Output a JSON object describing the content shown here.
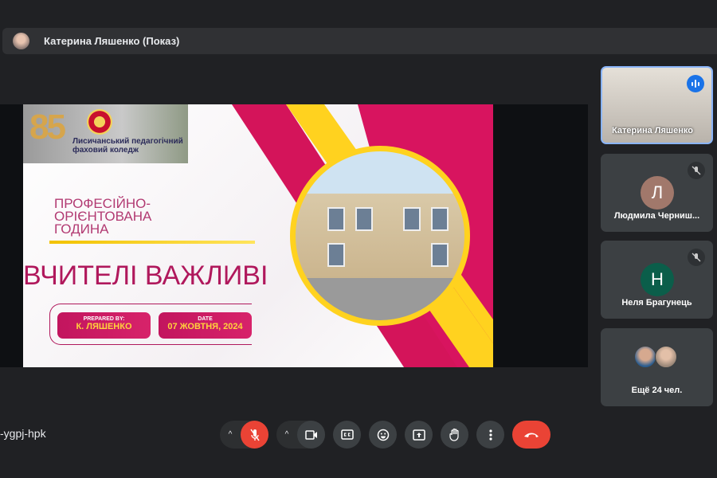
{
  "presenter_bar": {
    "title": "Катерина Ляшенко (Показ)"
  },
  "slide": {
    "logo_number": "85",
    "logo_line1": "Лисичанський педагогічний",
    "logo_line2": "фаховий коледж",
    "subtitle_line1": "ПРОФЕСІЙНО-",
    "subtitle_line2": "ОРІЄНТОВАНА",
    "subtitle_line3": "ГОДИНА",
    "headline": "ВЧИТЕЛІ ВАЖЛИВІ",
    "prepared_label": "PREPARED BY:",
    "prepared_value": "К. ЛЯШЕНКО",
    "date_label": "DATE",
    "date_value": "07 ЖОВТНЯ, 2024"
  },
  "participants": [
    {
      "name": "Катерина Ляшенко",
      "speaking": true
    },
    {
      "name": "Людмила Черниш...",
      "initial": "Л",
      "color": "#a1786b",
      "muted": true
    },
    {
      "name": "Неля Брагунець",
      "initial": "Н",
      "color": "#0b5e4a",
      "muted": true
    }
  ],
  "more_participants": "Ещё 24 чел.",
  "meeting_code": "-ygpj-hpk",
  "controls": {
    "mic": "muted",
    "camera": "on"
  }
}
